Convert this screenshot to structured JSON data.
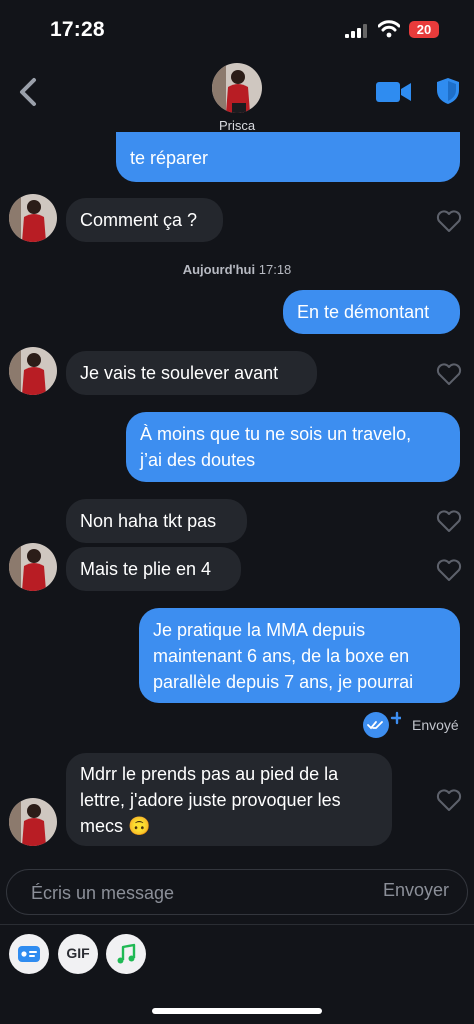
{
  "status_bar": {
    "time": "17:28",
    "battery": "20"
  },
  "header": {
    "contact_name": "Prisca"
  },
  "messages": {
    "m1": "te réparer",
    "m2": "Comment ça ?",
    "timestamp_day": "Aujourd'hui",
    "timestamp_time": "17:18",
    "m3": "En te démontant",
    "m4": "Je vais te soulever avant",
    "m5_line1": "À moins que tu ne sois un travelo,",
    "m5_line2": "j’ai des doutes",
    "m6": "Non haha tkt pas",
    "m7": "Mais te plie en 4",
    "m8_line1": "Je pratique la MMA depuis",
    "m8_line2": "maintenant 6 ans, de la boxe en",
    "m8_line3": "parallèle depuis 7 ans, je pourrai",
    "m9_line1": "Mdrr le prends pas au pied de la",
    "m9_line2": "lettre, j'adore juste provoquer les",
    "m9_line3": "mecs 🙃"
  },
  "status": {
    "sent_label": "Envoyé"
  },
  "composer": {
    "placeholder": "Écris un message",
    "send_label": "Envoyer"
  },
  "toolbar": {
    "gif_label": "GIF"
  },
  "colors": {
    "outgoing": "#3d8ef0",
    "incoming": "#24272d",
    "background": "#121419"
  }
}
